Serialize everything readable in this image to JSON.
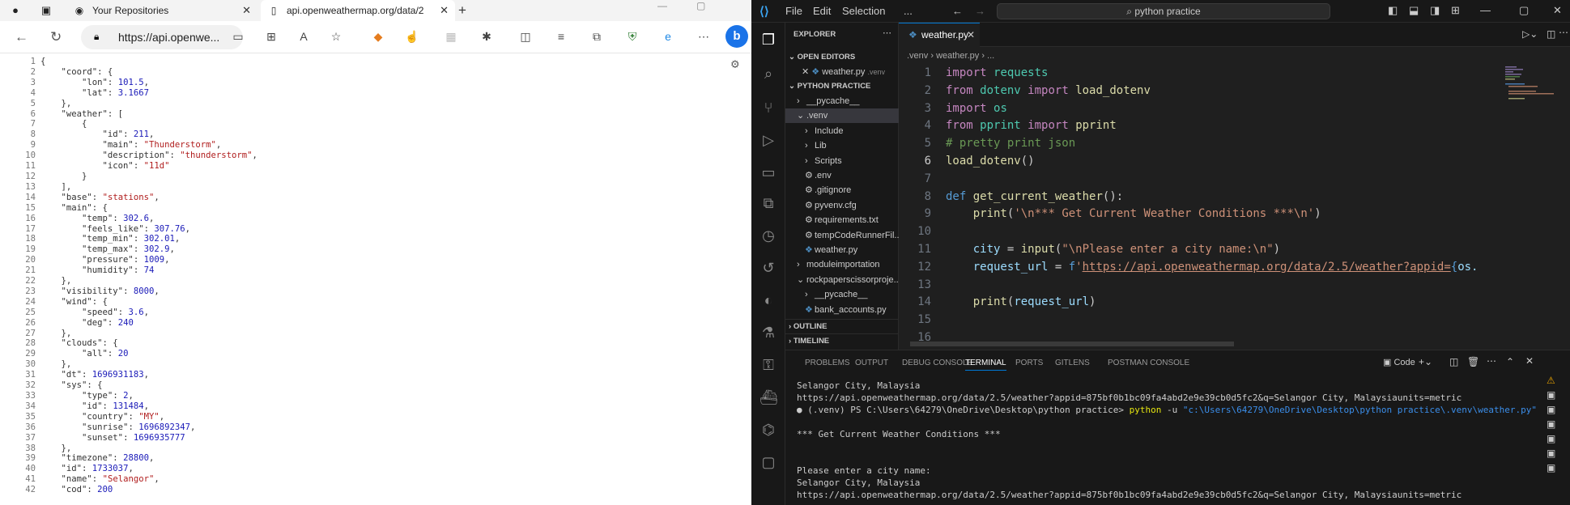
{
  "browser": {
    "tab1_title": "Your Repositories",
    "tab2_title": "api.openweathermap.org/data/2",
    "url": "https://api.openwe...",
    "line_numbers": [
      "1",
      "2",
      "3",
      "4",
      "5",
      "6",
      "7",
      "8",
      "9",
      "10",
      "11",
      "12",
      "13",
      "14",
      "15",
      "16",
      "17",
      "18",
      "19",
      "20",
      "21",
      "22",
      "23",
      "24",
      "25",
      "26",
      "27",
      "28",
      "29",
      "30",
      "31",
      "32",
      "33",
      "34",
      "35",
      "36",
      "37",
      "38",
      "39",
      "40",
      "41",
      "42"
    ]
  },
  "json_lines": [
    "{",
    "    \"coord\": {",
    "        \"lon\": 101.5,",
    "        \"lat\": 3.1667",
    "    },",
    "    \"weather\": [",
    "        {",
    "            \"id\": 211,",
    "            \"main\": \"Thunderstorm\",",
    "            \"description\": \"thunderstorm\",",
    "            \"icon\": \"11d\"",
    "        }",
    "    ],",
    "    \"base\": \"stations\",",
    "    \"main\": {",
    "        \"temp\": 302.6,",
    "        \"feels_like\": 307.76,",
    "        \"temp_min\": 302.01,",
    "        \"temp_max\": 302.9,",
    "        \"pressure\": 1009,",
    "        \"humidity\": 74",
    "    },",
    "    \"visibility\": 8000,",
    "    \"wind\": {",
    "        \"speed\": 3.6,",
    "        \"deg\": 240",
    "    },",
    "    \"clouds\": {",
    "        \"all\": 20",
    "    },",
    "    \"dt\": 1696931183,",
    "    \"sys\": {",
    "        \"type\": 2,",
    "        \"id\": 131484,",
    "        \"country\": \"MY\",",
    "        \"sunrise\": 1696892347,",
    "        \"sunset\": 1696935777",
    "    },",
    "    \"timezone\": 28800,",
    "    \"id\": 1733037,",
    "    \"name\": \"Selangor\",",
    "    \"cod\": 200"
  ],
  "vscode": {
    "menus": [
      "File",
      "Edit",
      "Selection",
      "..."
    ],
    "search": "python practice",
    "explorer_title": "EXPLORER",
    "open_editors": "OPEN EDITORS",
    "open_file": "weather.py",
    "open_file_dir": ".venv",
    "project": "PYTHON PRACTICE",
    "tree": [
      {
        "label": "__pycache__",
        "indent": 1,
        "chev": "›"
      },
      {
        "label": ".venv",
        "indent": 1,
        "chev": "⌄"
      },
      {
        "label": "Include",
        "indent": 2,
        "chev": "›"
      },
      {
        "label": "Lib",
        "indent": 2,
        "chev": "›"
      },
      {
        "label": "Scripts",
        "indent": 2,
        "chev": "›"
      },
      {
        "label": ".env",
        "indent": 2,
        "chev": ""
      },
      {
        "label": ".gitignore",
        "indent": 2,
        "chev": ""
      },
      {
        "label": "pyvenv.cfg",
        "indent": 2,
        "chev": ""
      },
      {
        "label": "requirements.txt",
        "indent": 2,
        "chev": ""
      },
      {
        "label": "tempCodeRunnerFil...",
        "indent": 2,
        "chev": ""
      },
      {
        "label": "weather.py",
        "indent": 2,
        "chev": ""
      },
      {
        "label": "moduleimportation",
        "indent": 1,
        "chev": "›"
      },
      {
        "label": "rockpaperscissorproje...",
        "indent": 1,
        "chev": "⌄"
      },
      {
        "label": "__pycache__",
        "indent": 2,
        "chev": "›"
      },
      {
        "label": "bank_accounts.py",
        "indent": 2,
        "chev": ""
      }
    ],
    "outline": "OUTLINE",
    "timeline": "TIMELINE",
    "tab": "weather.py",
    "breadcrumb": ".venv  ›  weather.py  ›  ...",
    "code_line_numbers": [
      "1",
      "2",
      "3",
      "4",
      "5",
      "6",
      "7",
      "8",
      "9",
      "10",
      "11",
      "12",
      "13",
      "14",
      "15",
      "16"
    ],
    "panel_tabs": [
      "PROBLEMS",
      "OUTPUT",
      "DEBUG CONSOLE",
      "TERMINAL",
      "PORTS",
      "GITLENS",
      "POSTMAN CONSOLE"
    ],
    "panel_right": "Code",
    "terminal": [
      "Selangor City, Malaysia",
      "https://api.openweathermap.org/data/2.5/weather?appid=875bf0b1bc09fa4abd2e9e39cb0d5fc2&q=Selangor City, Malaysiaunits=metric",
      "(.venv) PS C:\\Users\\64279\\OneDrive\\Desktop\\python practice> python -u \"c:\\Users\\64279\\OneDrive\\Desktop\\python practice\\.venv\\weather.py\"",
      "",
      "*** Get Current Weather Conditions ***",
      "",
      "",
      "Please enter a city name:",
      "Selangor City, Malaysia",
      "https://api.openweathermap.org/data/2.5/weather?appid=875bf0b1bc09fa4abd2e9e39cb0d5fc2&q=Selangor City, Malaysiaunits=metric"
    ]
  }
}
